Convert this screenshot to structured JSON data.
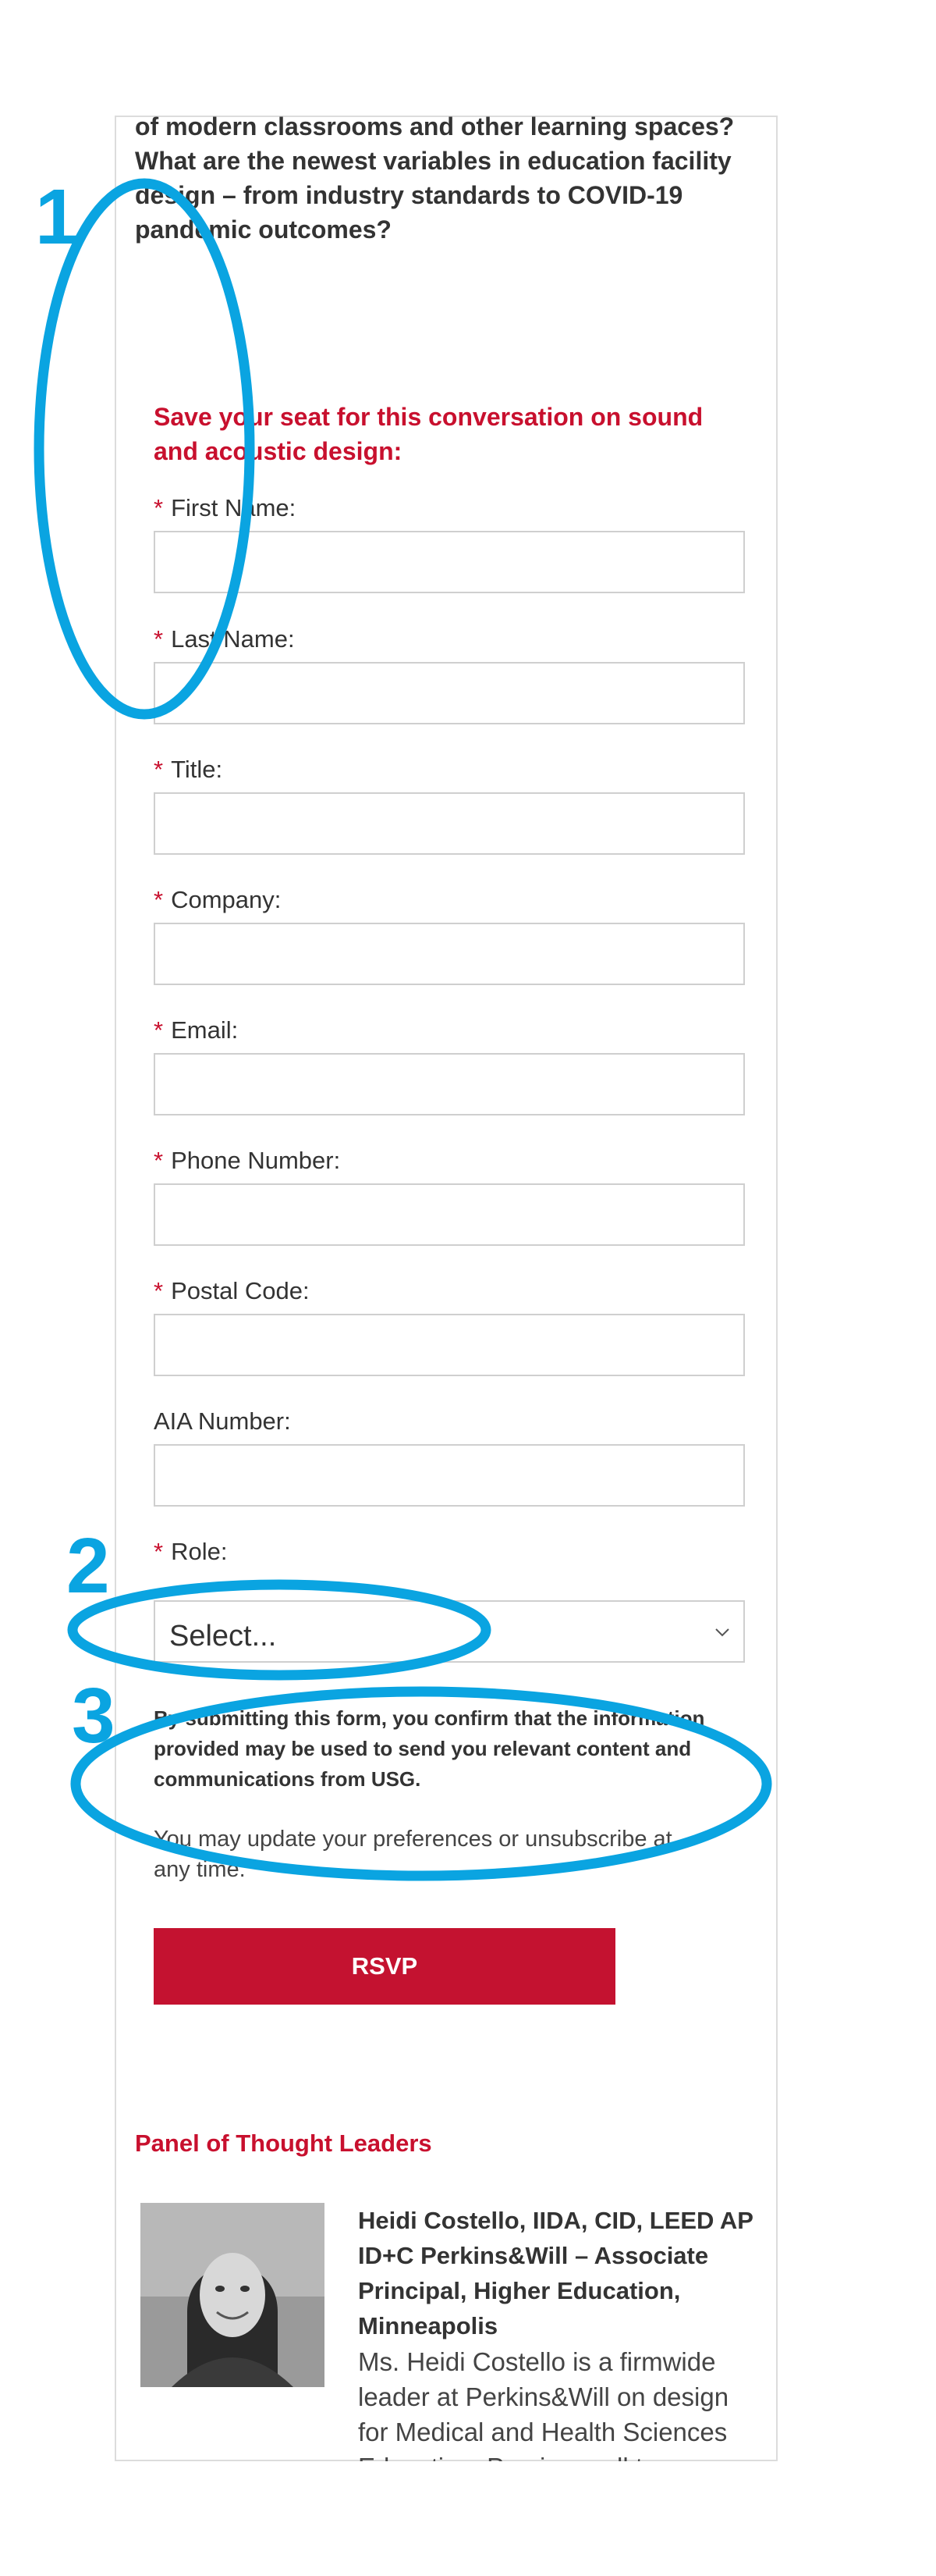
{
  "intro": {
    "text": "of modern classrooms and other learning spaces? What are the newest variables in education facility design – from industry standards to COVID-19 pandemic outcomes?"
  },
  "form": {
    "heading": "Save your seat for this conversation on sound and acoustic design:",
    "required_mark": "*",
    "fields": [
      {
        "label": "First Name:",
        "value": "",
        "required": true
      },
      {
        "label": "Last Name:",
        "value": "",
        "required": true
      },
      {
        "label": "Title:",
        "value": "",
        "required": true
      },
      {
        "label": "Company:",
        "value": "",
        "required": true
      },
      {
        "label": "Email:",
        "value": "",
        "required": true
      },
      {
        "label": "Phone Number:",
        "value": "",
        "required": true
      },
      {
        "label": "Postal Code:",
        "value": "",
        "required": true
      },
      {
        "label": "AIA Number:",
        "value": "",
        "required": false
      }
    ],
    "role": {
      "label": "Role:",
      "selected": "Select...",
      "required": true
    },
    "consent": "By submitting this form, you confirm that the information provided may be used to send you relevant content and communications from USG.",
    "unsubscribe": "You may update your preferences or unsubscribe at any time.",
    "submit_label": "RSVP"
  },
  "panel": {
    "title": "Panel of Thought Leaders",
    "speaker": {
      "name": "Heidi Costello, IIDA, CID, LEED AP ID+C  Perkins&Will – Associate Principal, Higher Education, Minneapolis",
      "bio": "Ms. Heidi Costello is a firmwide leader at Perkins&Will on design for Medical and Health Sciences Education. Previous roll to ..."
    }
  },
  "annotations": {
    "marker_1": "1",
    "marker_2": "2",
    "marker_3": "3"
  },
  "colors": {
    "accent_red": "#c8102e",
    "annotation_blue": "#0aa4e1",
    "border": "#cfcfcf"
  },
  "icons": {
    "select_arrow": "chevron-down-icon"
  }
}
